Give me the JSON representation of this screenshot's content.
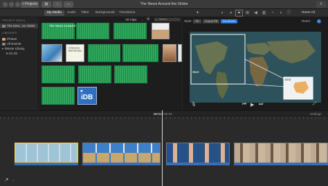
{
  "window": {
    "title": "The News Around the Globe",
    "projects_label": "< Projects",
    "reset_all": "Reset All"
  },
  "toolbar": {
    "tabs": [
      {
        "label": "My Media",
        "active": true
      },
      {
        "label": "Audio",
        "active": false
      },
      {
        "label": "Titles",
        "active": false
      },
      {
        "label": "Backgrounds",
        "active": false
      },
      {
        "label": "Transitions",
        "active": false
      }
    ]
  },
  "sidebar": {
    "project_heading": "PROJECT MEDIA",
    "project_item": "The New...ne Globe",
    "libraries_heading": "LIBRARIES",
    "items": [
      "Photos",
      "All Events",
      "iMovie Library",
      "5-21-19"
    ]
  },
  "browser": {
    "filter": "All Clips",
    "search_placeholder": "Search",
    "first_clip_title": "The News Around the Globe",
    "idb_label": "iDB",
    "thumb_text": "ETHICS IN REPORTING"
  },
  "viewer": {
    "style_label": "Style:",
    "style_options": [
      "Fit",
      "Crop to Fill",
      "Ken Burns"
    ],
    "active_style": "Ken Burns",
    "reset_label": "Reset",
    "start_label": "Start",
    "end_label": "End"
  },
  "timeline": {
    "current_time": "00:01",
    "separator": "/",
    "total_time": "00:22",
    "settings_label": "Settings"
  },
  "colors": {
    "accent": "#2d7ad8",
    "clip_green": "#2fa85d",
    "selection": "#f2c94c"
  }
}
